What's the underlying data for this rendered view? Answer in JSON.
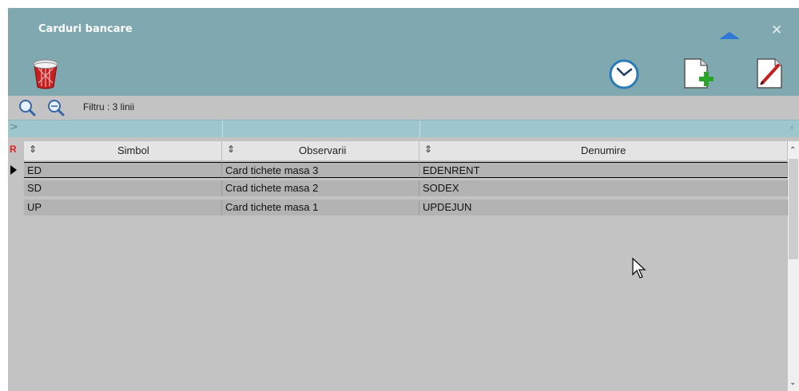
{
  "window": {
    "title": "Carduri bancare"
  },
  "filter": {
    "text": "Filtru : 3 linii"
  },
  "grid": {
    "marker": "R",
    "columns": [
      "Simbol",
      "Observarii",
      "Denumire"
    ],
    "rows": [
      {
        "simbol": "ED",
        "observatii": "Card tichete masa 3",
        "denumire": "EDENRENT"
      },
      {
        "simbol": "SD",
        "observatii": "Crad tichete masa 2",
        "denumire": "SODEX"
      },
      {
        "simbol": "UP",
        "observatii": "Card tichete masa 1",
        "denumire": "UPDEJUN"
      }
    ],
    "current_row": 0
  },
  "icons": {
    "trash": "trash-bin-icon",
    "history": "clock-icon",
    "add": "new-document-icon",
    "edit": "edit-document-icon",
    "zoom_in": "zoom-icon",
    "zoom_filter": "zoom-filter-icon"
  },
  "colors": {
    "titlebar": "#7fa8b1",
    "groupbar": "#9ec6cd",
    "row": "#b3b3b3",
    "accent_blue": "#2d78d6",
    "marker_red": "#e02020"
  }
}
